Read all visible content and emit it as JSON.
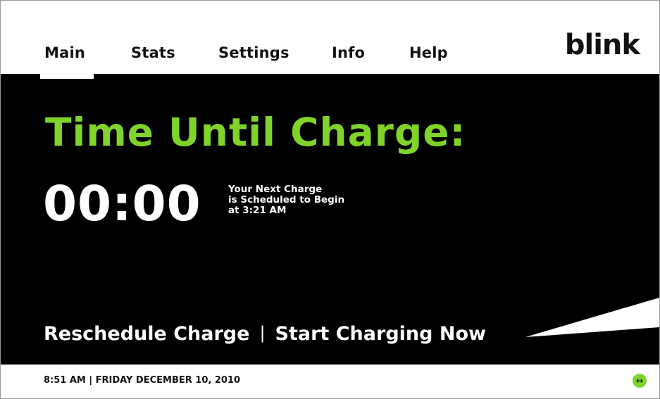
{
  "nav": {
    "tabs": [
      {
        "label": "Main"
      },
      {
        "label": "Stats"
      },
      {
        "label": "Settings"
      },
      {
        "label": "Info"
      },
      {
        "label": "Help"
      }
    ],
    "active": "Main",
    "logo": "blink"
  },
  "main": {
    "title": "Time Until Charge:",
    "timer": "00:00",
    "schedule_lines": [
      "Your Next Charge",
      "is Scheduled to Begin",
      "at 3:21 AM"
    ],
    "reschedule_label": "Reschedule Charge",
    "separator": "|",
    "start_label": "Start Charging Now"
  },
  "footer": {
    "status": "8:51 AM | FRIDAY DECEMBER 10, 2010",
    "icon": "swap-arrows-icon"
  },
  "colors": {
    "accent": "#80d32b",
    "panel": "#000000",
    "text": "#111111"
  }
}
